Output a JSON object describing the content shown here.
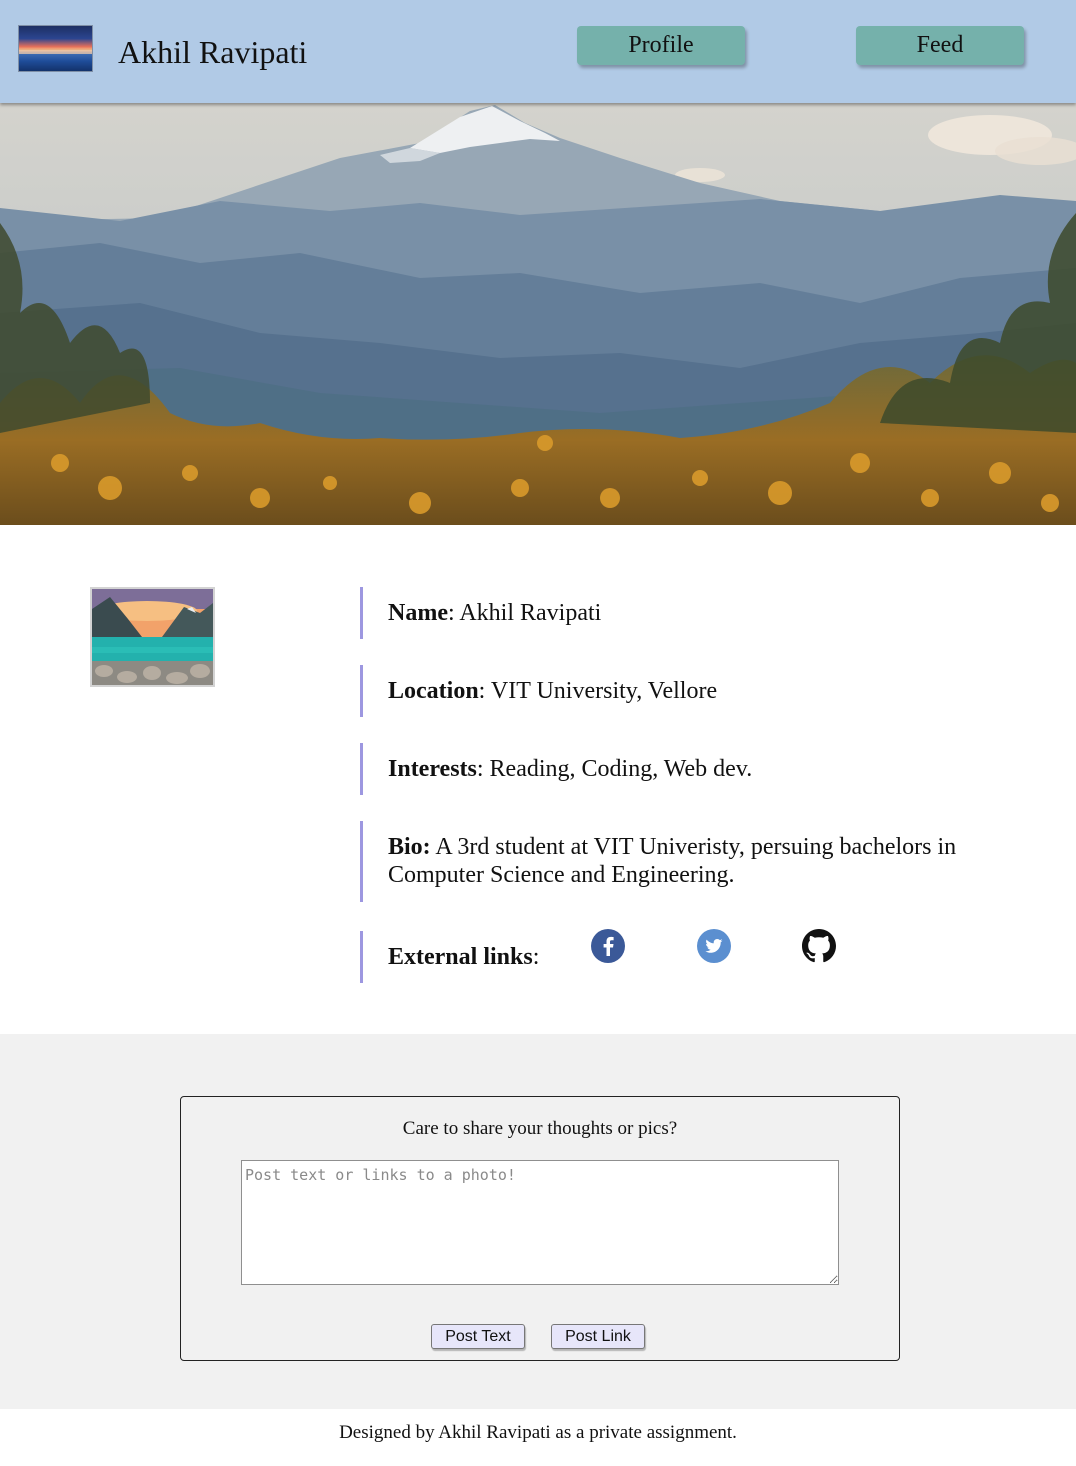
{
  "header": {
    "title": "Akhil Ravipati",
    "nav": [
      {
        "label": "Profile"
      },
      {
        "label": "Feed"
      }
    ]
  },
  "profile": {
    "name_label": "Name",
    "name_value": ": Akhil Ravipati",
    "location_label": "Location",
    "location_value": ": VIT University, Vellore",
    "interests_label": "Interests",
    "interests_value": ": Reading, Coding, Web dev.",
    "bio_label": "Bio:",
    "bio_value": " A 3rd student at VIT Univeristy, persuing bachelors in Computer Science and Engineering.",
    "external_label": "External links",
    "external_colon": ":",
    "links": [
      {
        "icon": "facebook-icon",
        "color": "#3b5998"
      },
      {
        "icon": "twitter-icon",
        "color": "#5b8fd0"
      },
      {
        "icon": "github-icon",
        "color": "#111111"
      }
    ]
  },
  "post": {
    "prompt": "Care to share your thoughts or pics?",
    "placeholder": "Post text or links to a photo!",
    "post_text_label": "Post Text",
    "post_link_label": "Post Link"
  },
  "footer": {
    "text": "Designed by Akhil Ravipati as a private assignment."
  },
  "colors": {
    "header_bg": "#b1cae6",
    "nav_button": "#75b1ab",
    "accent_border": "#9d97e0",
    "section_bg": "#f1f1f1",
    "post_button": "#e7e6fa"
  }
}
